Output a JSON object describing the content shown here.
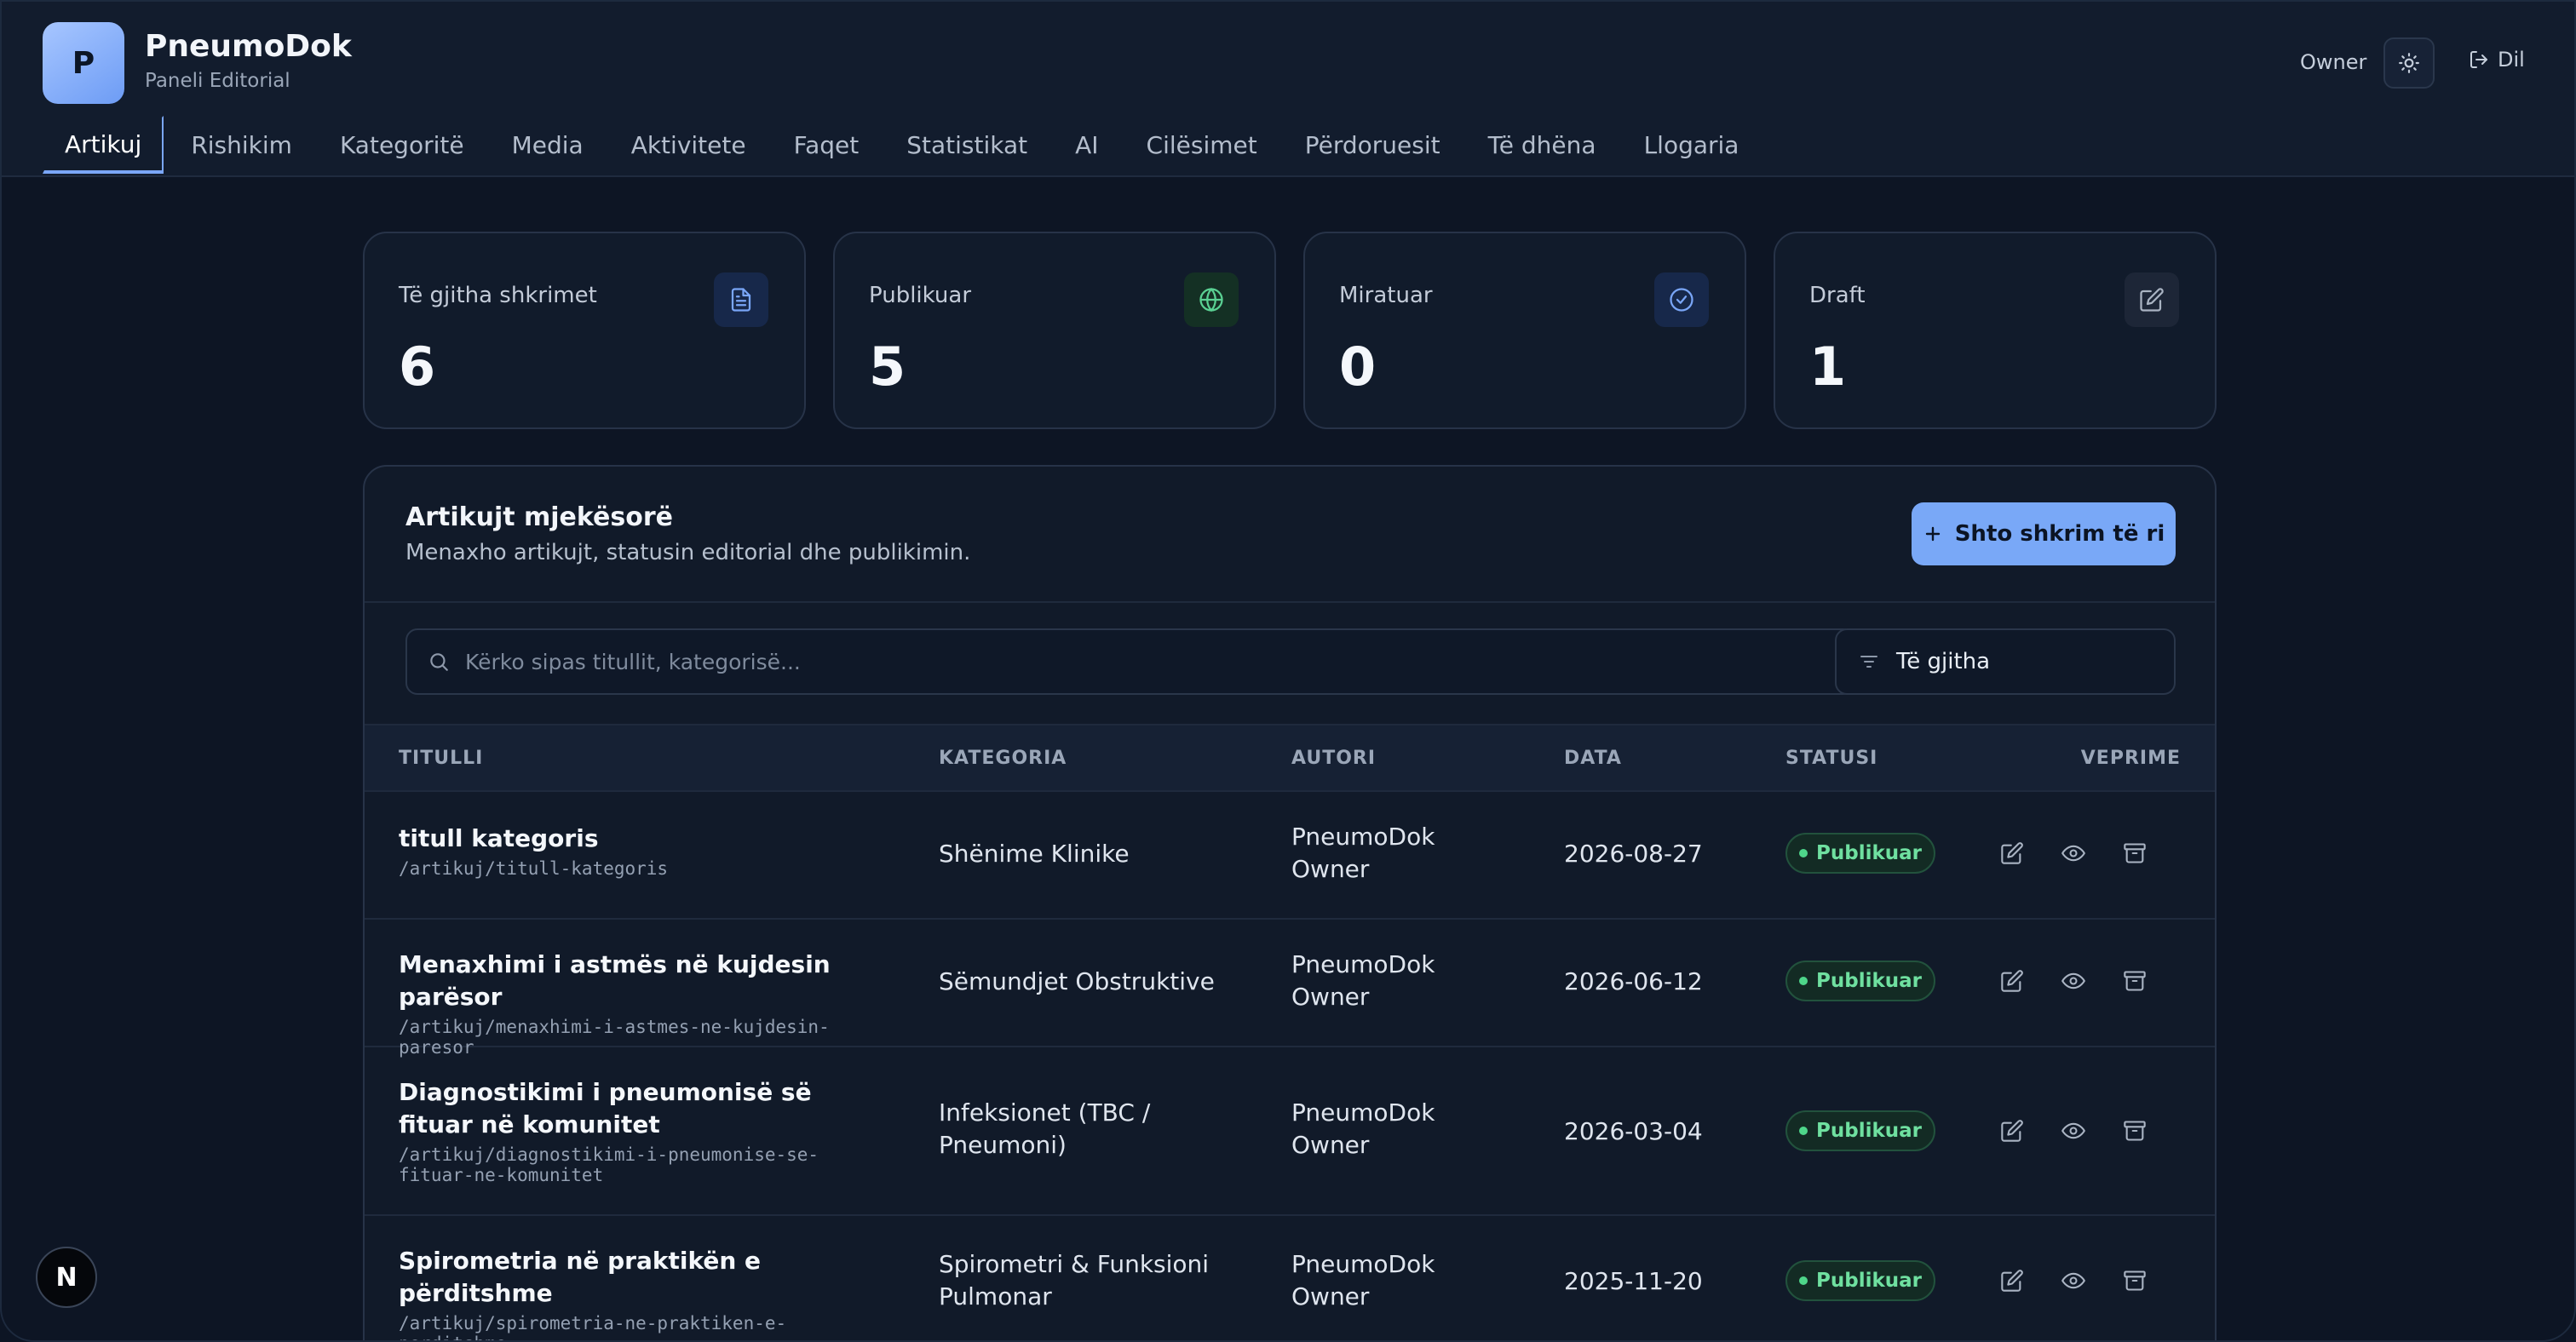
{
  "app": {
    "logo_letter": "P",
    "name": "PneumoDok",
    "subtitle": "Paneli Editorial",
    "role": "Owner",
    "logout_label": "Dil"
  },
  "nav": [
    {
      "label": "Artikuj",
      "active": true
    },
    {
      "label": "Rishikim"
    },
    {
      "label": "Kategoritë"
    },
    {
      "label": "Media"
    },
    {
      "label": "Aktivitete"
    },
    {
      "label": "Faqet"
    },
    {
      "label": "Statistikat"
    },
    {
      "label": "AI"
    },
    {
      "label": "Cilësimet"
    },
    {
      "label": "Përdoruesit"
    },
    {
      "label": "Të dhëna"
    },
    {
      "label": "Llogaria"
    }
  ],
  "stats": [
    {
      "label": "Të gjitha shkrimet",
      "value": "6",
      "icon": "document-icon",
      "color": "#7aa6f7"
    },
    {
      "label": "Publikuar",
      "value": "5",
      "icon": "globe-icon",
      "color": "#5ad193"
    },
    {
      "label": "Miratuar",
      "value": "0",
      "icon": "check-circle-icon",
      "color": "#7aa6f7"
    },
    {
      "label": "Draft",
      "value": "1",
      "icon": "edit-icon",
      "color": "#aab4c3"
    }
  ],
  "panel": {
    "title": "Artikujt mjekësorë",
    "subtitle": "Menaxho artikujt, statusin editorial dhe publikimin.",
    "add_button": "Shto shkrim të ri",
    "search_placeholder": "Kërko sipas titullit, kategorisë...",
    "filter_value": "Të gjitha"
  },
  "table": {
    "headers": {
      "title": "TITULLI",
      "category": "KATEGORIA",
      "author": "AUTORI",
      "date": "DATA",
      "status": "STATUSI",
      "actions": "VEPRIME"
    },
    "rows": [
      {
        "title": "titull kategoris",
        "slug": "/artikuj/titull-kategoris",
        "category": "Shënime Klinike",
        "author": "PneumoDok Owner",
        "date": "2026-08-27",
        "status": "Publikuar"
      },
      {
        "title": "Menaxhimi i astmës në kujdesin parësor",
        "slug": "/artikuj/menaxhimi-i-astmes-ne-kujdesin-paresor",
        "category": "Sëmundjet Obstruktive",
        "author": "PneumoDok Owner",
        "date": "2026-06-12",
        "status": "Publikuar"
      },
      {
        "title": "Diagnostikimi i pneumonisë së fituar në komunitet",
        "slug": "/artikuj/diagnostikimi-i-pneumonise-se-fituar-ne-komunitet",
        "category": "Infeksionet (TBC / Pneumoni)",
        "author": "PneumoDok Owner",
        "date": "2026-03-04",
        "status": "Publikuar"
      },
      {
        "title": "Spirometria në praktikën e përditshme",
        "slug": "/artikuj/spirometria-ne-praktiken-e-perditshme",
        "category": "Spirometri & Funksioni Pulmonar",
        "author": "PneumoDok Owner",
        "date": "2025-11-20",
        "status": "Publikuar"
      }
    ]
  },
  "dev_badge": "N"
}
